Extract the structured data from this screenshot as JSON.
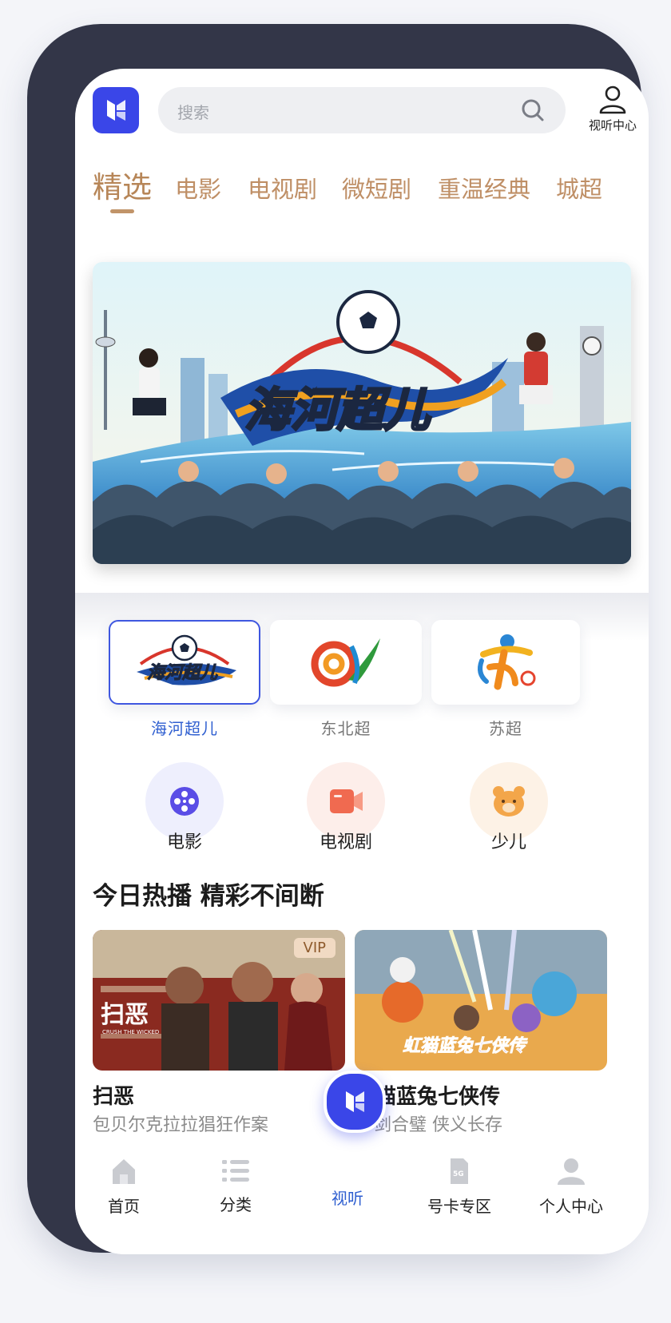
{
  "header": {
    "search_placeholder": "搜索",
    "user_center_label": "视听中心"
  },
  "tabs": [
    {
      "label": "精选",
      "active": true
    },
    {
      "label": "电影"
    },
    {
      "label": "电视剧"
    },
    {
      "label": "微短剧"
    },
    {
      "label": "重温经典"
    },
    {
      "label": "城超"
    }
  ],
  "banner": {
    "title_art": "海河超儿"
  },
  "leagues": [
    {
      "label": "海河超儿",
      "logo_text": "海河超儿",
      "selected": true
    },
    {
      "label": "东北超"
    },
    {
      "label": "苏超"
    }
  ],
  "categories": [
    {
      "label": "电影",
      "icon": "film-reel-icon"
    },
    {
      "label": "电视剧",
      "icon": "video-camera-icon"
    },
    {
      "label": "少儿",
      "icon": "bear-icon"
    }
  ],
  "section": {
    "title": "今日热播 精彩不间断"
  },
  "cards": [
    {
      "title": "扫恶",
      "subtitle": "包贝尔克拉拉猖狂作案",
      "badge": "VIP",
      "poster_text": "扫恶",
      "poster_subtext": "CRUSH THE WICKED"
    },
    {
      "title": "虹猫蓝兔七侠传",
      "subtitle": "剑合璧 侠义长存",
      "poster_text": "虹猫蓝兔七侠传"
    }
  ],
  "bottom_nav": [
    {
      "label": "首页",
      "icon": "home-icon"
    },
    {
      "label": "分类",
      "icon": "list-icon"
    },
    {
      "label": "视听",
      "icon": "app-logo-icon",
      "active": true
    },
    {
      "label": "号卡专区",
      "icon": "sim-card-5g-icon"
    },
    {
      "label": "个人中心",
      "icon": "person-icon"
    }
  ],
  "colors": {
    "brand": "#3a46e8",
    "tab_accent": "#b78658",
    "selected_blue": "#2f5fd0",
    "phone_frame": "#333648"
  }
}
